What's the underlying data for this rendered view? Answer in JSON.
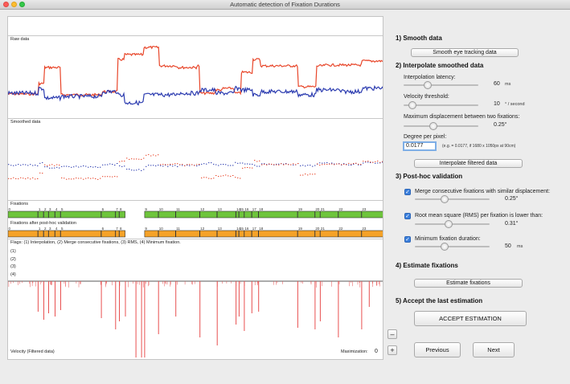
{
  "window": {
    "title": "Automatic detection of Fixation Durations"
  },
  "plots": {
    "raw_label": "Raw data",
    "smoothed_label": "Smoothed data",
    "fixations_label": "Fixations",
    "fixations_post_label": "Fixations after post-hoc validation",
    "flags_label": "Flags: (1) Interpolation, (2) Merge consecutive fixations, (3) RMS, (4)  Minimum fixation.",
    "flag_rows": [
      "(1)",
      "(2)",
      "(3)",
      "(4)"
    ],
    "velocity_label": "Velocity (Filtered data)",
    "maximization_label": "Maximization:",
    "maximization_value": "0"
  },
  "fixations": {
    "row1": [
      {
        "n": "0",
        "s": 0,
        "e": 0.08
      },
      {
        "n": "1",
        "s": 0.08,
        "e": 0.095
      },
      {
        "n": "2",
        "s": 0.095,
        "e": 0.108
      },
      {
        "n": "3",
        "s": 0.108,
        "e": 0.125
      },
      {
        "n": "4",
        "s": 0.125,
        "e": 0.14
      },
      {
        "n": "5",
        "s": 0.14,
        "e": 0.248
      },
      {
        "n": "6",
        "s": 0.248,
        "e": 0.286
      },
      {
        "n": "7",
        "s": 0.286,
        "e": 0.296
      },
      {
        "n": "8",
        "s": 0.296,
        "e": 0.312
      },
      {
        "n": "9",
        "s": 0.363,
        "e": 0.4
      },
      {
        "n": "10",
        "s": 0.4,
        "e": 0.446
      },
      {
        "n": "11",
        "s": 0.446,
        "e": 0.51
      },
      {
        "n": "12",
        "s": 0.51,
        "e": 0.556
      },
      {
        "n": "13",
        "s": 0.556,
        "e": 0.606
      },
      {
        "n": "14",
        "s": 0.606,
        "e": 0.614
      },
      {
        "n": "15",
        "s": 0.614,
        "e": 0.628
      },
      {
        "n": "16",
        "s": 0.628,
        "e": 0.648
      },
      {
        "n": "17",
        "s": 0.648,
        "e": 0.666
      },
      {
        "n": "18",
        "s": 0.666,
        "e": 0.77
      },
      {
        "n": "19",
        "s": 0.77,
        "e": 0.816
      },
      {
        "n": "20",
        "s": 0.816,
        "e": 0.83
      },
      {
        "n": "21",
        "s": 0.83,
        "e": 0.878
      },
      {
        "n": "22",
        "s": 0.878,
        "e": 0.94
      },
      {
        "n": "23",
        "s": 0.94,
        "e": 1.0
      }
    ],
    "row2": [
      {
        "n": "0",
        "s": 0,
        "e": 0.08
      },
      {
        "n": "1",
        "s": 0.08,
        "e": 0.095
      },
      {
        "n": "2",
        "s": 0.095,
        "e": 0.108
      },
      {
        "n": "3",
        "s": 0.108,
        "e": 0.125
      },
      {
        "n": "4",
        "s": 0.125,
        "e": 0.14
      },
      {
        "n": "5",
        "s": 0.14,
        "e": 0.248
      },
      {
        "n": "6",
        "s": 0.248,
        "e": 0.286
      },
      {
        "n": "7",
        "s": 0.286,
        "e": 0.296
      },
      {
        "n": "8",
        "s": 0.296,
        "e": 0.312
      },
      {
        "n": "9",
        "s": 0.363,
        "e": 0.4
      },
      {
        "n": "10",
        "s": 0.4,
        "e": 0.446
      },
      {
        "n": "11",
        "s": 0.446,
        "e": 0.51
      },
      {
        "n": "12",
        "s": 0.51,
        "e": 0.556
      },
      {
        "n": "13",
        "s": 0.556,
        "e": 0.606
      },
      {
        "n": "14",
        "s": 0.606,
        "e": 0.614
      },
      {
        "n": "15",
        "s": 0.614,
        "e": 0.628
      },
      {
        "n": "16",
        "s": 0.628,
        "e": 0.648
      },
      {
        "n": "17",
        "s": 0.648,
        "e": 0.666
      },
      {
        "n": "18",
        "s": 0.666,
        "e": 0.77
      },
      {
        "n": "19",
        "s": 0.77,
        "e": 0.816
      },
      {
        "n": "20",
        "s": 0.816,
        "e": 0.83
      },
      {
        "n": "21",
        "s": 0.83,
        "e": 0.878
      },
      {
        "n": "22",
        "s": 0.878,
        "e": 0.94
      },
      {
        "n": "23",
        "s": 0.94,
        "e": 1.0
      }
    ]
  },
  "sections": {
    "smooth": {
      "title": "1) Smooth data",
      "button": "Smooth eye tracking data"
    },
    "interpolate": {
      "title": "2) Interpolate smoothed data",
      "latency_label": "Interpolation latency:",
      "latency_value": "60",
      "latency_unit": "ms",
      "latency_level": 0.32,
      "velocity_label": "Velocity threshold:",
      "velocity_value": "10",
      "velocity_unit": "° / second",
      "velocity_level": 0.12,
      "displacement_label": "Maximum displacement between two fixations:",
      "displacement_value": "0.25°",
      "displacement_level": 0.4,
      "dpp_label": "Degree per pixel:",
      "dpp_value": "0.0177",
      "dpp_hint": "(e.g. = 0.0177, if 1680 x 1050px at 90cm)",
      "button": "Interpolate filtered data"
    },
    "posthoc": {
      "title": "3) Post-hoc validation",
      "merge_label": "Merge consecutive fixations with similar displacement:",
      "merge_value": "0.25°",
      "merge_level": 0.4,
      "rms_label": "Root mean square (RMS) per fixation is lower than:",
      "rms_value": "0.31°",
      "rms_level": 0.45,
      "min_label": "Minimum fixation duration:",
      "min_value": "50",
      "min_unit": "ms",
      "min_level": 0.4
    },
    "estimate": {
      "title": "4) Estimate fixations",
      "button": "Estimate fixations"
    },
    "accept": {
      "title": "5) Accept the last estimation",
      "button": "ACCEPT ESTIMATION"
    }
  },
  "nav": {
    "previous": "Previous",
    "next": "Next",
    "minus": "–",
    "plus": "+"
  },
  "colors": {
    "red": "#e8462a",
    "blue": "#2c3cb0",
    "green": "#6ec43c",
    "orange": "#f5a228",
    "spike": "#e85050"
  }
}
